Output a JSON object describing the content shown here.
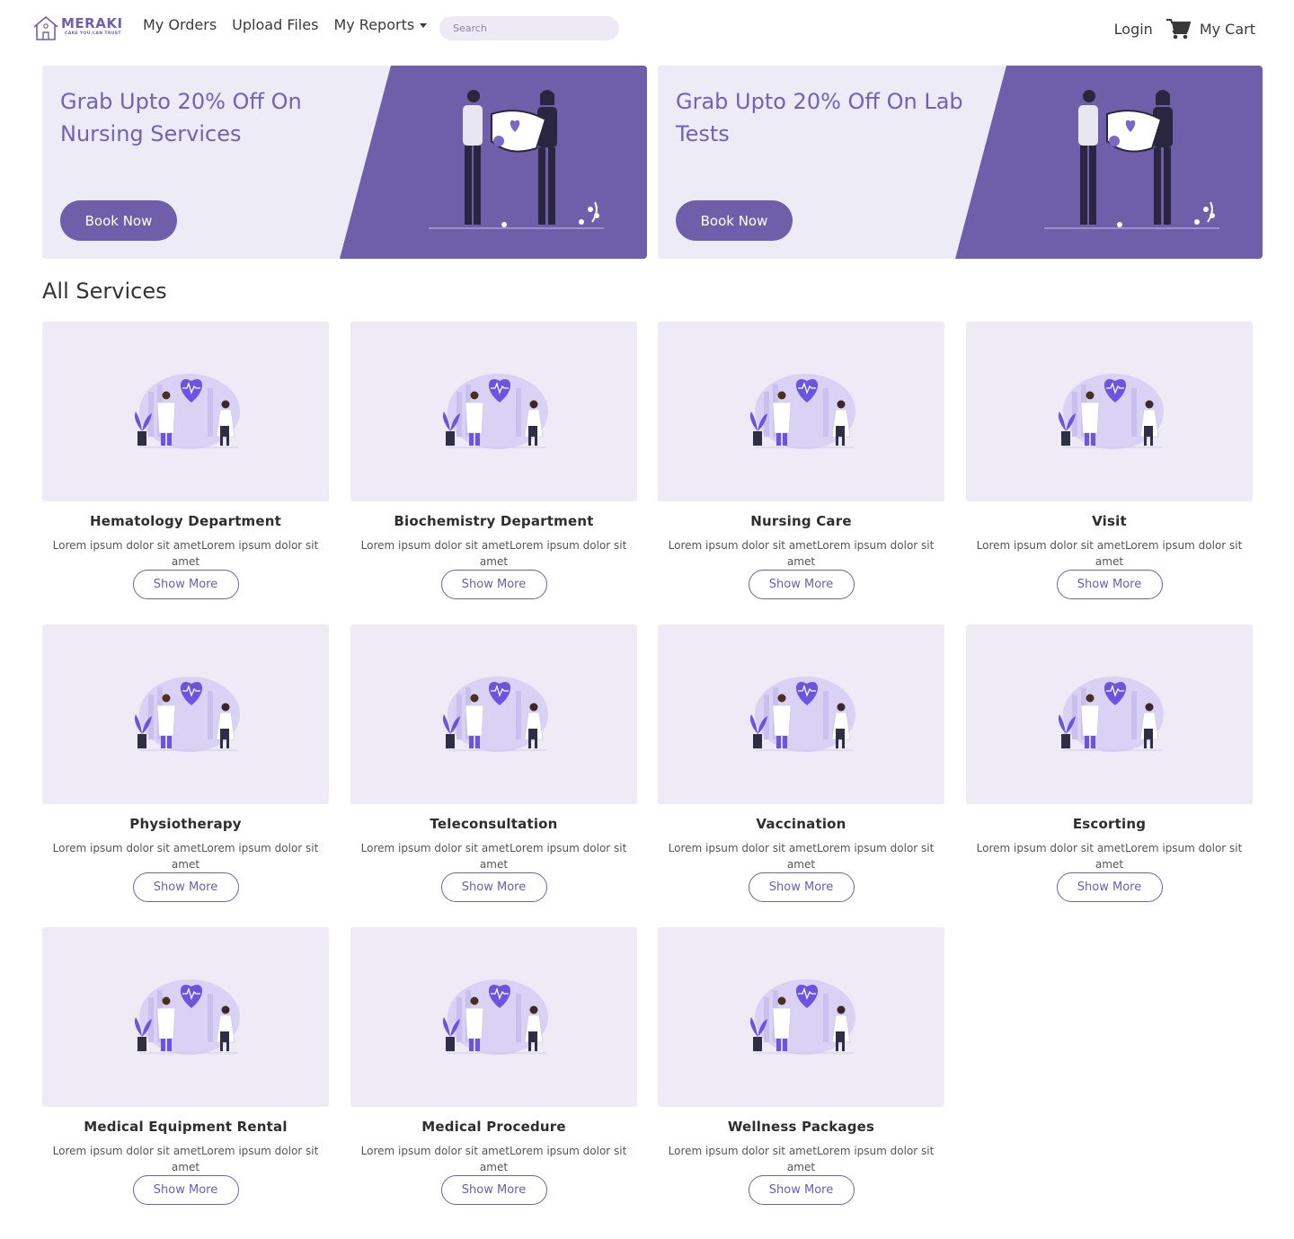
{
  "brand": {
    "name": "MERAKI",
    "tagline": "CARE YOU CAN TRUST"
  },
  "nav": {
    "my_orders": "My Orders",
    "upload_files": "Upload Files",
    "my_reports": "My Reports",
    "search_placeholder": "Search",
    "login": "Login",
    "my_cart": "My Cart"
  },
  "banners": [
    {
      "title": "Grab Upto 20% Off On Nursing Services",
      "button": "Book Now"
    },
    {
      "title": "Grab Upto 20% Off On Lab Tests",
      "button": "Book Now"
    }
  ],
  "colors": {
    "accent": "#6f5ea9",
    "light": "#edebf6"
  },
  "section_title": "All Services",
  "services": [
    {
      "title": "Hematology Department",
      "desc": "Lorem ipsum dolor sit ametLorem ipsum dolor sit amet",
      "button": "Show More"
    },
    {
      "title": "Biochemistry Department",
      "desc": "Lorem ipsum dolor sit ametLorem ipsum dolor sit amet",
      "button": "Show More"
    },
    {
      "title": "Nursing Care",
      "desc": "Lorem ipsum dolor sit ametLorem ipsum dolor sit amet",
      "button": "Show More"
    },
    {
      "title": "Visit",
      "desc": "Lorem ipsum dolor sit ametLorem ipsum dolor sit amet",
      "button": "Show More"
    },
    {
      "title": "Physiotherapy",
      "desc": "Lorem ipsum dolor sit ametLorem ipsum dolor sit amet",
      "button": "Show More"
    },
    {
      "title": "Teleconsultation",
      "desc": "Lorem ipsum dolor sit ametLorem ipsum dolor sit amet",
      "button": "Show More"
    },
    {
      "title": "Vaccination",
      "desc": "Lorem ipsum dolor sit ametLorem ipsum dolor sit amet",
      "button": "Show More"
    },
    {
      "title": "Escorting",
      "desc": "Lorem ipsum dolor sit ametLorem ipsum dolor sit amet",
      "button": "Show More"
    },
    {
      "title": "Medical Equipment Rental",
      "desc": "Lorem ipsum dolor sit ametLorem ipsum dolor sit amet",
      "button": "Show More"
    },
    {
      "title": "Medical Procedure",
      "desc": "Lorem ipsum dolor sit ametLorem ipsum dolor sit amet",
      "button": "Show More"
    },
    {
      "title": "Wellness Packages",
      "desc": "Lorem ipsum dolor sit ametLorem ipsum dolor sit amet",
      "button": "Show More"
    }
  ]
}
